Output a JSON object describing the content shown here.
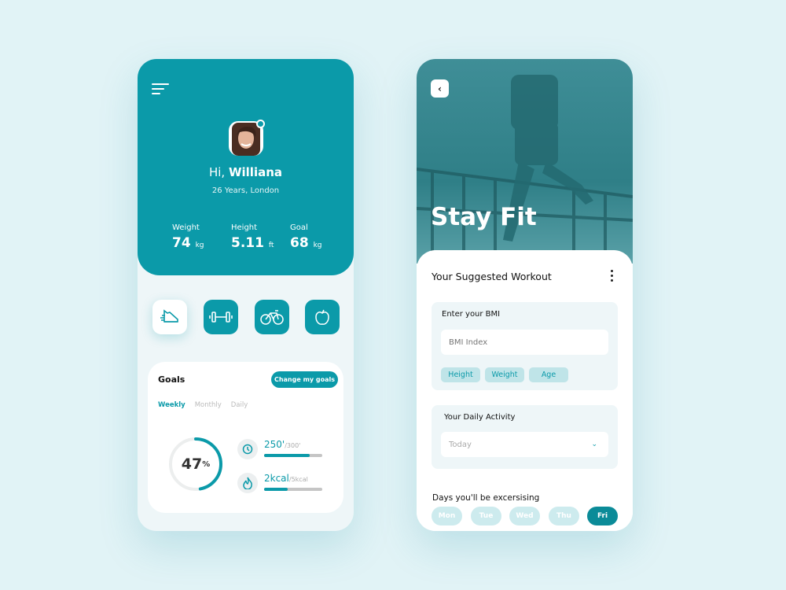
{
  "colors": {
    "accent": "#0b9aa9",
    "background": "#e1f3f6"
  },
  "profile": {
    "greeting": "Hi,",
    "name": "Williana",
    "subtitle": "26 Years, London",
    "stats": [
      {
        "label": "Weight",
        "value": "74",
        "unit": "kg"
      },
      {
        "label": "Height",
        "value": "5.11",
        "unit": "ft"
      },
      {
        "label": "Goal",
        "value": "68",
        "unit": "kg"
      }
    ]
  },
  "categories": [
    {
      "icon": "sneaker-icon",
      "active": true
    },
    {
      "icon": "dumbbell-icon"
    },
    {
      "icon": "bicycle-icon"
    },
    {
      "icon": "apple-icon"
    }
  ],
  "goals": {
    "title": "Goals",
    "button": "Change my goals",
    "tabs": [
      "Weekly",
      "Monthly",
      "Daily"
    ],
    "active_tab": "Weekly",
    "percent": "47",
    "percent_sign": "%",
    "progress": 0.47,
    "metrics": [
      {
        "icon": "clock-icon",
        "value": "250'",
        "target": "/300'",
        "progress": 0.78
      },
      {
        "icon": "flame-icon",
        "value": "2kcal",
        "target": "/5kcal",
        "progress": 0.4
      }
    ]
  },
  "workout": {
    "hero_title": "Stay Fit",
    "section_title": "Your Suggested Workout",
    "bmi": {
      "label": "Enter your BMI",
      "placeholder": "BMI Index",
      "chips": [
        "Height",
        "Weight",
        "Age"
      ]
    },
    "activity": {
      "label": "Your Daily Activity",
      "selected": "Today"
    },
    "days_label": "Days you'll be excersising",
    "days": [
      "Mon",
      "Tue",
      "Wed",
      "Thu",
      "Fri"
    ],
    "selected_day": "Fri"
  }
}
